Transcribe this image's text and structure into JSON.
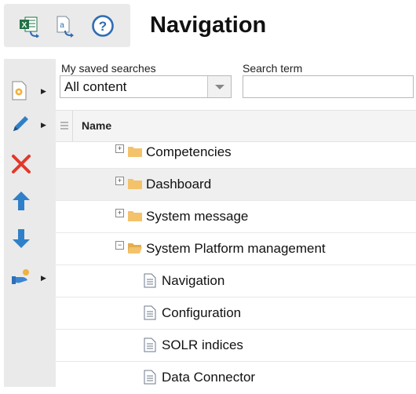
{
  "header": {
    "title": "Navigation",
    "toolbar_icons": [
      "excel-export-icon",
      "translate-export-icon",
      "help-icon"
    ]
  },
  "sidebar_tools": [
    "new-item-icon",
    "edit-icon",
    "delete-icon",
    "move-up-icon",
    "move-down-icon",
    "assign-icon"
  ],
  "filters": {
    "saved_searches_label": "My saved searches",
    "saved_searches_value": "All content",
    "search_term_label": "Search term",
    "search_term_value": ""
  },
  "grid": {
    "column_name": "Name",
    "rows": [
      {
        "label": "Competencies",
        "type": "folder",
        "expanded": false
      },
      {
        "label": "Dashboard",
        "type": "folder",
        "expanded": false,
        "selected": true
      },
      {
        "label": "System message",
        "type": "folder",
        "expanded": false
      },
      {
        "label": "System Platform management",
        "type": "folder",
        "expanded": true
      },
      {
        "label": "Navigation",
        "type": "page"
      },
      {
        "label": "Configuration",
        "type": "page"
      },
      {
        "label": "SOLR indices",
        "type": "page"
      },
      {
        "label": "Data Connector",
        "type": "page"
      }
    ]
  },
  "colors": {
    "toolbar_bg": "#eaeaea",
    "excel_green": "#217346",
    "help_blue": "#2e6db4",
    "delete_red": "#e2382a",
    "arrow_blue": "#2f80c8",
    "folder_yellow": "#f3c26a"
  }
}
